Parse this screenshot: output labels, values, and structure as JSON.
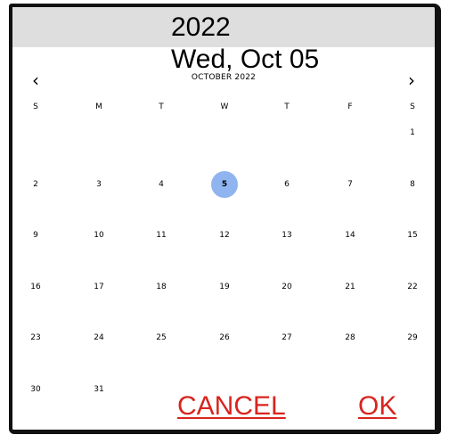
{
  "header": {
    "year": "2022",
    "date": "Wed, Oct 05"
  },
  "nav": {
    "prev_icon": "chevron-left-icon",
    "prev_glyph": "‹",
    "next_icon": "chevron-right-icon",
    "next_glyph": "›",
    "month_label": "OCTOBER 2022"
  },
  "weekdays": [
    "S",
    "M",
    "T",
    "W",
    "T",
    "F",
    "S"
  ],
  "weeks": [
    [
      "",
      "",
      "",
      "",
      "",
      "",
      "1"
    ],
    [
      "2",
      "3",
      "4",
      "5",
      "6",
      "7",
      "8"
    ],
    [
      "9",
      "10",
      "11",
      "12",
      "13",
      "14",
      "15"
    ],
    [
      "16",
      "17",
      "18",
      "19",
      "20",
      "21",
      "22"
    ],
    [
      "23",
      "24",
      "25",
      "26",
      "27",
      "28",
      "29"
    ],
    [
      "30",
      "31",
      "",
      "",
      "",
      "",
      ""
    ]
  ],
  "selected_day": "5",
  "actions": {
    "cancel_label": "CANCEL",
    "ok_label": "OK"
  },
  "colors": {
    "header_bg": "#dedede",
    "selected_bg": "#8fb4ef",
    "action_text": "#d8241e"
  }
}
